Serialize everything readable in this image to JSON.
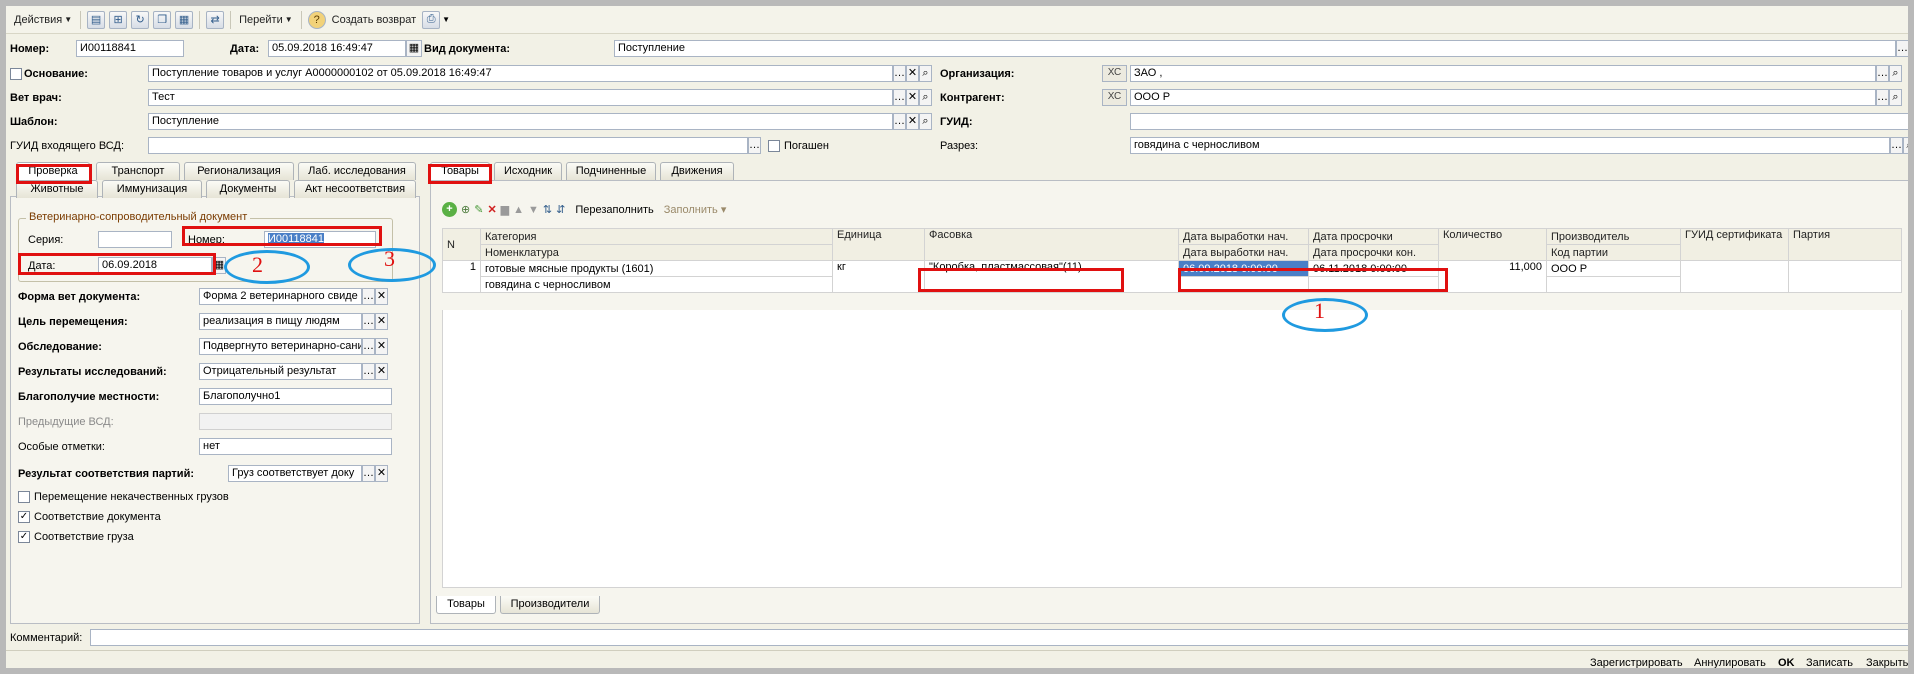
{
  "toolbar": {
    "actions": "Действия",
    "goto": "Перейти",
    "create_return": "Создать возврат",
    "help": "?"
  },
  "header": {
    "number_label": "Номер:",
    "number_value": "И00118841",
    "date_label": "Дата:",
    "date_value": "05.09.2018 16:49:47",
    "doctype_label": "Вид документа:",
    "doctype_value": "Поступление",
    "basis_label": "Основание:",
    "basis_value": "Поступление товаров и услуг А0000000102 от 05.09.2018 16:49:47",
    "vet_label": "Вет врач:",
    "vet_value": "Тест",
    "template_label": "Шаблон:",
    "template_value": "Поступление",
    "guid_in_label": "ГУИД входящего ВСД:",
    "guid_in_value": "",
    "repaid_label": "Погашен",
    "org_label": "Организация:",
    "org_xc": "ХС",
    "org_value": "ЗАО                                                          ,",
    "contractor_label": "Контрагент:",
    "contractor_xc": "ХС",
    "contractor_value": "ООО Р",
    "guid_label": "ГУИД:",
    "guid_value": "",
    "section_label": "Разрез:",
    "section_value": "говядина с черносливом"
  },
  "left_tabs": {
    "row1": [
      "Проверка",
      "Транспорт",
      "Регионализация",
      "Лаб. исследования"
    ],
    "row2": [
      "Животные",
      "Иммунизация",
      "Документы",
      "Акт несоответствия"
    ]
  },
  "vsd": {
    "group_title": "Ветеринарно-сопроводительный документ",
    "series_label": "Серия:",
    "series_value": "",
    "number_label": "Номер:",
    "number_value": "И00118841",
    "date_label": "Дата:",
    "date_value": "06.09.2018"
  },
  "form": {
    "form_label": "Форма вет документа:",
    "form_value": "Форма 2 ветеринарного свиде",
    "purpose_label": "Цель перемещения:",
    "purpose_value": "реализация в пищу людям",
    "exam_label": "Обследование:",
    "exam_value": "Подвергнуто ветеринарно-сани",
    "results_label": "Результаты исследований:",
    "results_value": "Отрицательный результат",
    "wellbeing_label": "Благополучие местности:",
    "wellbeing_value": "Благополучно1",
    "prev_label": "Предыдущие ВСД:",
    "prev_value": "",
    "marks_label": "Особые отметки:",
    "marks_value": "нет",
    "match_label": "Результат соответствия партий:",
    "match_value": "Груз соответствует доку",
    "chk_bad_label": "Перемещение некачественных грузов",
    "chk_doc_label": "Соответствие документа",
    "chk_cargo_label": "Соответствие груза"
  },
  "right_tabs": [
    "Товары",
    "Исходник",
    "Подчиненные",
    "Движения"
  ],
  "goods_toolbar": {
    "refill": "Перезаполнить",
    "fill": "Заполнить"
  },
  "table": {
    "headers_top": [
      "N",
      "Категория",
      "Единица",
      "Фасовка",
      "Дата выработки нач.",
      "Дата просрочки",
      "Количество",
      "Производитель",
      "ГУИД сертификата",
      "Партия"
    ],
    "headers_bottom": [
      "Номенклатура",
      "Дата выработки нач.",
      "Дата просрочки кон.",
      "Код партии"
    ],
    "rows": [
      {
        "n": "1",
        "category": "готовые мясные продукты (1601)",
        "nomenclature": "говядина с черносливом",
        "unit": "кг",
        "packing": "\"Коробка, пластмассовая\"(11)",
        "prod_date": "06.09.2018 0:00:00",
        "exp_date": "06.11.2018 0:00:00",
        "qty": "11,000",
        "producer": "ООО Р"
      }
    ]
  },
  "bottom_tabs": [
    "Товары",
    "Производители"
  ],
  "comment_label": "Комментарий:",
  "footer": {
    "register": "Зарегистрировать",
    "cancel": "Аннулировать",
    "ok": "OK",
    "save": "Записать",
    "close": "Закрыть"
  },
  "annotations": [
    "1",
    "2",
    "3"
  ],
  "colors": {
    "highlight": "#e01010",
    "ellipse": "#1f9ae0",
    "selection": "#4a7fc7"
  }
}
